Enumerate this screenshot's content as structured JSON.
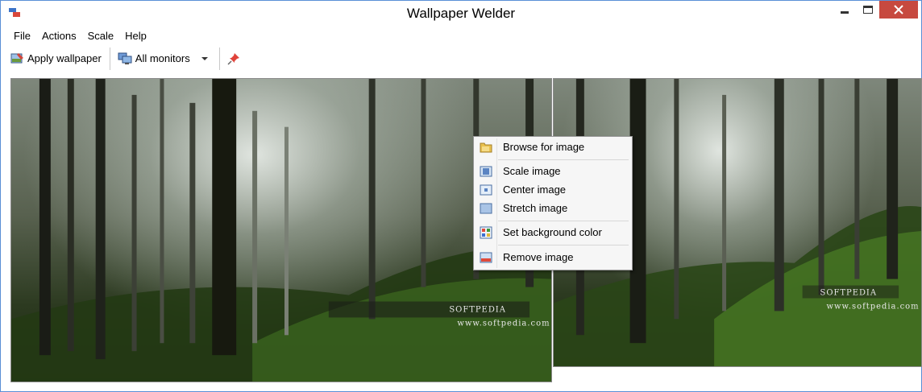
{
  "window": {
    "title": "Wallpaper Welder"
  },
  "menu": {
    "file": "File",
    "actions": "Actions",
    "scale": "Scale",
    "help": "Help"
  },
  "toolbar": {
    "apply_label": "Apply wallpaper",
    "monitors_label": "All monitors"
  },
  "context_menu": {
    "items": [
      {
        "label": "Browse for image",
        "icon": "folder-icon"
      },
      {
        "label": "Scale image",
        "icon": "scale-icon"
      },
      {
        "label": "Center image",
        "icon": "center-icon"
      },
      {
        "label": "Stretch image",
        "icon": "stretch-icon"
      },
      {
        "label": "Set background color",
        "icon": "palette-icon"
      },
      {
        "label": "Remove image",
        "icon": "remove-image-icon"
      }
    ]
  },
  "watermark": {
    "brand": "SOFTPEDIA",
    "url": "www.softpedia.com"
  },
  "colors": {
    "close_button": "#c7493f",
    "frame_border": "#5a8fd6"
  }
}
